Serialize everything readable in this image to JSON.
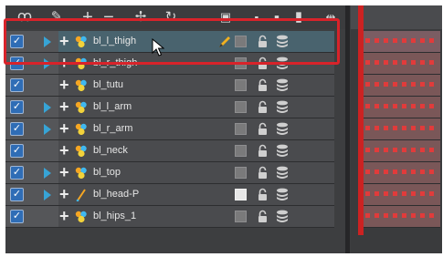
{
  "toolbar": {
    "icons": [
      "onion-skin-icon",
      "add-drawing-layer-icon",
      "add-layer-icon",
      "delete-layer-icon",
      "add-peg-icon",
      "transform-icon",
      "camera-icon",
      "colour-swatch-icon",
      "lock-all-icon",
      "show-all-icon",
      "sync-icon"
    ]
  },
  "layers": [
    {
      "name": "bl_l_thigh",
      "selected": true,
      "expandable": true,
      "type": "drawing",
      "swatch": "grey"
    },
    {
      "name": "bl_r_thigh",
      "selected": false,
      "expandable": true,
      "type": "drawing",
      "swatch": "grey"
    },
    {
      "name": "bl_tutu",
      "selected": false,
      "expandable": false,
      "type": "drawing",
      "swatch": "grey"
    },
    {
      "name": "bl_l_arm",
      "selected": false,
      "expandable": true,
      "type": "drawing",
      "swatch": "grey"
    },
    {
      "name": "bl_r_arm",
      "selected": false,
      "expandable": true,
      "type": "drawing",
      "swatch": "grey"
    },
    {
      "name": "bl_neck",
      "selected": false,
      "expandable": false,
      "type": "drawing",
      "swatch": "grey"
    },
    {
      "name": "bl_top",
      "selected": false,
      "expandable": true,
      "type": "drawing",
      "swatch": "grey"
    },
    {
      "name": "bl_head-P",
      "selected": false,
      "expandable": true,
      "type": "peg",
      "swatch": "light"
    },
    {
      "name": "bl_hips_1",
      "selected": false,
      "expandable": false,
      "type": "drawing",
      "swatch": "grey"
    }
  ],
  "colors": {
    "accent": "#37a4d6",
    "selected_row": "#49636e",
    "highlight_box": "#d8232a",
    "keyframe": "#e13b3b",
    "playhead": "#cc2222"
  }
}
